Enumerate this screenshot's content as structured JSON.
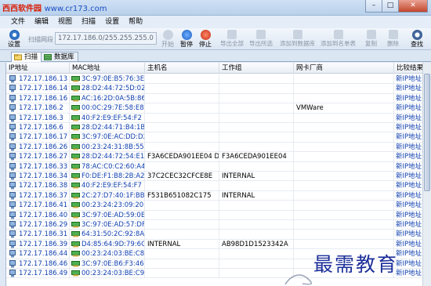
{
  "titlebar": {
    "site_name": "西西软件园",
    "site_url": "www.cr173.com"
  },
  "menu": [
    "文件",
    "编辑",
    "视图",
    "扫描",
    "设置",
    "帮助"
  ],
  "toolbar": {
    "settings": "设置",
    "range_label": "扫描网段",
    "range_value": "172.17.186.0/255.255.255.0",
    "start": "开始",
    "pause": "暂停",
    "stop": "停止",
    "export_all": "导出全部",
    "export_selected": "导出所选",
    "add_to_db": "添加到数据库",
    "add_to_db_list": "添加到名单表",
    "copy": "复制",
    "delete": "删除",
    "find": "查找"
  },
  "tabs": [
    {
      "label": "扫描",
      "active": true
    },
    {
      "label": "数据库",
      "active": false
    }
  ],
  "table": {
    "columns": [
      "IP地址",
      "MAC地址",
      "主机名",
      "工作组",
      "网卡厂商",
      "比较结果"
    ],
    "rows": [
      [
        "172.17.186.13",
        "3C:97:0E:B5:76:3E",
        "",
        "",
        "",
        "新IP地址"
      ],
      [
        "172.17.186.14",
        "28:D2:44:72:5D:02",
        "",
        "",
        "",
        "新IP地址"
      ],
      [
        "172.17.186.16",
        "AC:16:2D:0A:5B:86",
        "",
        "",
        "",
        "新IP地址"
      ],
      [
        "172.17.186.2",
        "00:0C:29:7E:58:E8",
        "",
        "",
        "VMWare",
        "新IP地址"
      ],
      [
        "172.17.186.3",
        "40:F2:E9:EF:54:F2",
        "",
        "",
        "",
        "新IP地址"
      ],
      [
        "172.17.186.6",
        "28:D2:44:71:B4:1B",
        "",
        "",
        "",
        "新IP地址"
      ],
      [
        "172.17.186.17",
        "3C:97:0E:AC:DD:D2",
        "",
        "",
        "",
        "新IP地址"
      ],
      [
        "172.17.186.26",
        "00:23:24:31:8B:55",
        "",
        "",
        "",
        "新IP地址"
      ],
      [
        "172.17.186.27",
        "28:D2:44:72:54:E1",
        "F3A6CEDA901EE04 D",
        "F3A6CEDA901EE04",
        "",
        "新IP地址"
      ],
      [
        "172.17.186.33",
        "78:AC:C0:C2:60:A4",
        "",
        "",
        "",
        "新IP地址"
      ],
      [
        "172.17.186.34",
        "F0:DE:F1:B8:2B:A2",
        "37C2CEC32CFCE8E",
        "INTERNAL",
        "",
        "新IP地址"
      ],
      [
        "172.17.186.38",
        "40:F2:E9:EF:54:F7",
        "",
        "",
        "",
        "新IP地址"
      ],
      [
        "172.17.186.37",
        "2C:27:D7:40:1F:BB",
        "F531B651082C175",
        "INTERNAL",
        "",
        "新IP地址"
      ],
      [
        "172.17.186.41",
        "00:23:24:23:09:20",
        "",
        "",
        "",
        "新IP地址"
      ],
      [
        "172.17.186.40",
        "3C:97:0E:AD:59:0E",
        "",
        "",
        "",
        "新IP地址"
      ],
      [
        "172.17.186.29",
        "3C:97:0E:AD:57:DF",
        "",
        "",
        "",
        "新IP地址"
      ],
      [
        "172.17.186.31",
        "64:31:50:2C:92:8A",
        "",
        "",
        "",
        "新IP地址"
      ],
      [
        "172.17.186.39",
        "D4:85:64:9D:79:6C",
        "INTERNAL",
        "AB98D1D1523342A",
        "",
        "新IP地址"
      ],
      [
        "172.17.186.44",
        "00:23:24:03:BE:C8",
        "",
        "",
        "",
        "新IP地址"
      ],
      [
        "172.17.186.46",
        "3C:97:0E:B6:F3:46",
        "",
        "",
        "",
        "新IP地址"
      ],
      [
        "172.17.186.49",
        "00:23:24:03:BE:C9",
        "",
        "",
        "",
        "新IP地址"
      ]
    ]
  },
  "watermark": "最需教育",
  "colors": {
    "link_blue": "#1040b0",
    "brand_red": "#d81e06",
    "watermark": "#1c2f9a"
  }
}
